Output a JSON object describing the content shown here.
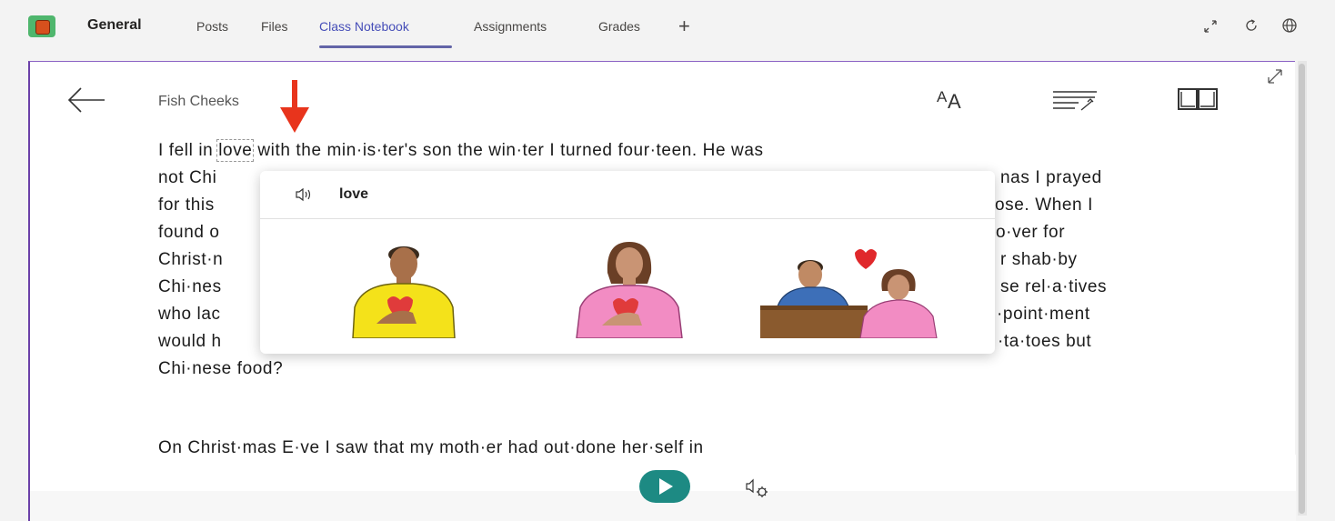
{
  "topbar": {
    "channel": "General",
    "tabs": [
      "Posts",
      "Files",
      "Class Notebook",
      "Assignments",
      "Grades"
    ],
    "active_tab": "Class Notebook",
    "add_tab": "+",
    "icons": [
      "expand-icon",
      "refresh-icon",
      "globe-icon"
    ]
  },
  "reader": {
    "title": "Fish Cheeks",
    "toolbar_icons": [
      "text-preferences-icon",
      "grammar-options-icon",
      "reading-preferences-icon"
    ],
    "lines": [
      {
        "before": "I fell in ",
        "word": "love",
        "after": " with the min·is·ter's son the win·ter I turned four·teen. He was"
      },
      {
        "left": "not Chi",
        "right": "nas I prayed"
      },
      {
        "left": "for this",
        "right": "ose. When I"
      },
      {
        "left": "found o",
        "right": "o·ver for"
      },
      {
        "left": "Christ·n",
        "right": "r shab·by"
      },
      {
        "left": "Chi·nes",
        "right": "se rel·a·tives"
      },
      {
        "left": "who lac",
        "right": "·point·ment"
      },
      {
        "left": "would h",
        "right": "·ta·toes but"
      },
      {
        "left": "Chi·nese food?",
        "right": ""
      }
    ],
    "next_paragraph": "On Christ·mas E·ve I saw that my moth·er had out·done her·self in"
  },
  "picture_dictionary": {
    "word": "love",
    "speaker_icon": "speaker-icon",
    "pictures": [
      "man-hand-on-heart",
      "woman-hand-on-heart",
      "couple-with-heart"
    ]
  },
  "playback": {
    "play_icon": "play-icon",
    "voice_settings_icon": "voice-settings-icon"
  },
  "colors": {
    "accent": "#6264a7",
    "frame_border": "#6b40a8",
    "play": "#1d8a83",
    "indicator_arrow": "#e8341c"
  }
}
